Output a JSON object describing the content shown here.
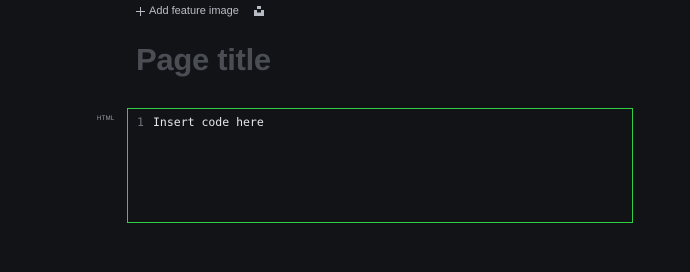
{
  "feature_image": {
    "add_label": "Add feature image",
    "plus_icon": "plus-icon",
    "unsplash_icon": "unsplash-icon"
  },
  "title": {
    "placeholder": "Page title"
  },
  "html_card": {
    "label": "HTML",
    "line_number": "1",
    "placeholder": "Insert code here",
    "border_color": "#30cf43"
  },
  "colors": {
    "background": "#121317",
    "title_placeholder": "#4a4d54",
    "accent_green": "#30cf43"
  }
}
